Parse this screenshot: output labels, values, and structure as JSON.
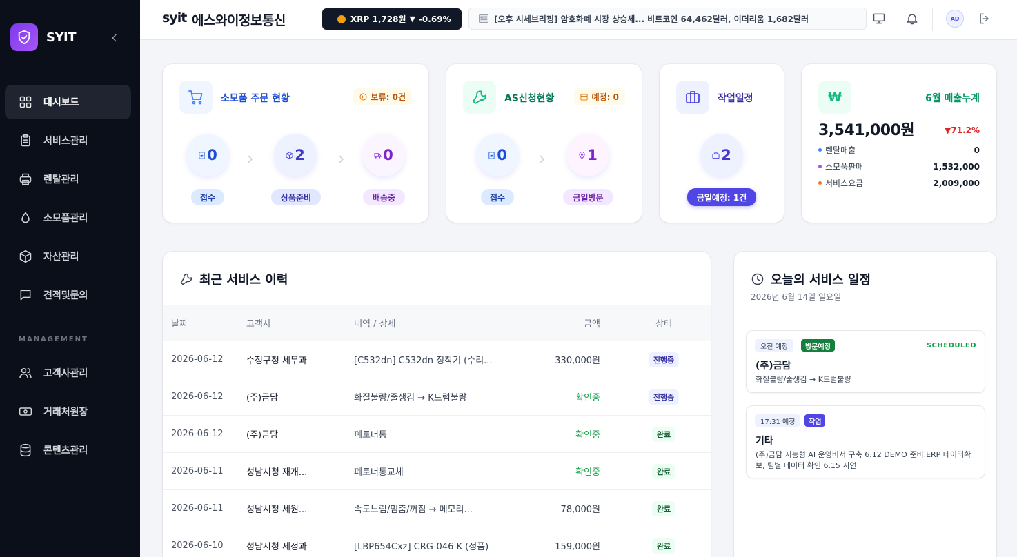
{
  "sidebar": {
    "brand": "SYIT",
    "items": [
      {
        "label": "대시보드",
        "icon": "grid-icon",
        "active": true
      },
      {
        "label": "서비스관리",
        "icon": "clipboard-icon"
      },
      {
        "label": "렌탈관리",
        "icon": "printer-icon"
      },
      {
        "label": "소모품관리",
        "icon": "droplet-icon"
      },
      {
        "label": "자산관리",
        "icon": "box-icon"
      },
      {
        "label": "견적및문의",
        "icon": "message-icon"
      }
    ],
    "section_label": "MANAGEMENT",
    "management_items": [
      {
        "label": "고객사관리",
        "icon": "users-icon"
      },
      {
        "label": "거래처원장",
        "icon": "ledger-icon"
      },
      {
        "label": "콘텐츠관리",
        "icon": "database-icon"
      }
    ]
  },
  "header": {
    "logo": "syit",
    "title": "에스와이정보통신",
    "ticker": {
      "coin": "XRP",
      "price": "1,728원",
      "direction": "▼",
      "change": "-0.69%"
    },
    "news": "[오후 시세브리핑] 암호화폐 시장 상승세... 비트코인 64,462달러, 이더리움 1,682달러",
    "avatar": "AD"
  },
  "orders": {
    "title": "소모품 주문 현황",
    "pending": "보류: 0건",
    "stages": [
      {
        "value": "0",
        "label": "접수"
      },
      {
        "value": "2",
        "label": "상품준비"
      },
      {
        "value": "0",
        "label": "배송중"
      }
    ]
  },
  "as": {
    "title": "AS신청현황",
    "scheduled": "예정: 0",
    "stages": [
      {
        "value": "0",
        "label": "접수"
      },
      {
        "value": "1",
        "label": "금일방문"
      }
    ]
  },
  "work": {
    "title": "작업일정",
    "value": "2",
    "label": "금일예정: 1건"
  },
  "revenue": {
    "title": "6월 매출누계",
    "currency_symbol": "₩",
    "amount": "3,541,000원",
    "change": "▼71.2%",
    "rows": [
      {
        "label": "렌탈매출",
        "value": "0",
        "color": "#3b82f6"
      },
      {
        "label": "소모품판매",
        "value": "1,532,000",
        "color": "#a855f7"
      },
      {
        "label": "서비스요금",
        "value": "2,009,000",
        "color": "#f97316"
      }
    ]
  },
  "history": {
    "title": "최근 서비스 이력",
    "columns": [
      "날짜",
      "고객사",
      "내역 / 상세",
      "금액",
      "상태"
    ],
    "rows": [
      {
        "date": "2026-06-12",
        "customer": "수정구청 세무과",
        "desc": "[C532dn] C532dn 정착기 (수리...",
        "amount": "330,000원",
        "status": "진행중"
      },
      {
        "date": "2026-06-12",
        "customer": "(주)금담",
        "desc": "화질불량/줄생김 → K드럼불량",
        "amount": "확인중",
        "status": "진행중"
      },
      {
        "date": "2026-06-12",
        "customer": "(주)금담",
        "desc": "폐토너통",
        "amount": "확인중",
        "status": "완료"
      },
      {
        "date": "2026-06-11",
        "customer": "성남시청 재개...",
        "desc": "폐토너통교체",
        "amount": "확인중",
        "status": "완료"
      },
      {
        "date": "2026-06-11",
        "customer": "성남시청 세원...",
        "desc": "속도느림/멈춤/꺼짐 → 메모리...",
        "amount": "78,000원",
        "status": "완료"
      },
      {
        "date": "2026-06-10",
        "customer": "성남시청 세정과",
        "desc": "[LBP654Cxz] CRG-046 K (정품)",
        "amount": "159,000원",
        "status": "완료"
      }
    ]
  },
  "schedule": {
    "title": "오늘의 서비스 일정",
    "date": "2026년 6월 14일 일요일",
    "items": [
      {
        "time": "오전 예정",
        "tag": "방문예정",
        "tag_color": "#15803d",
        "state": "SCHEDULED",
        "title": "(주)금담",
        "desc": "화질불량/줄생김 → K드럼불량"
      },
      {
        "time": "17:31 예정",
        "tag": "작업",
        "tag_color": "#4f46e5",
        "state": "",
        "title": "기타",
        "desc": "(주)금담 지능형 AI 운영비서 구축 6.12 DEMO 준비.ERP 데이터확보, 팀별 데이터 확인 6.15 시연"
      }
    ]
  }
}
